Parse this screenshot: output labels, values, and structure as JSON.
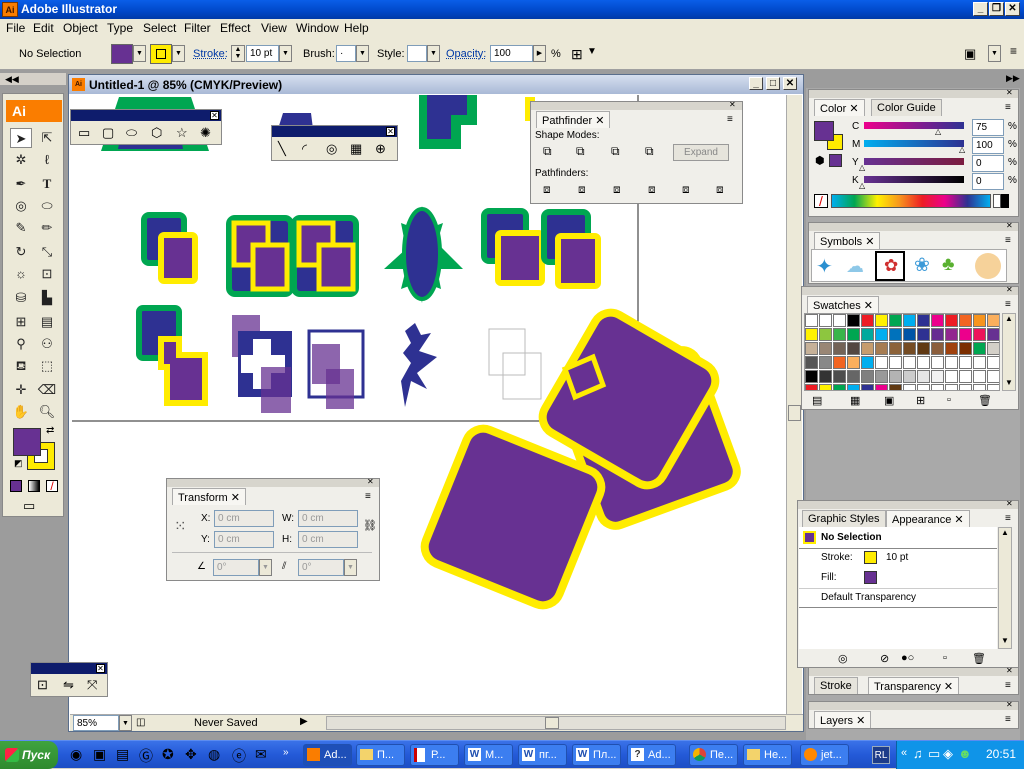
{
  "window": {
    "title": "Adobe Illustrator",
    "app_icon": "Ai"
  },
  "menu": [
    "File",
    "Edit",
    "Object",
    "Type",
    "Select",
    "Filter",
    "Effect",
    "View",
    "Window",
    "Help"
  ],
  "control": {
    "selection": "No Selection",
    "stroke_label": "Stroke:",
    "stroke_value": "10 pt",
    "brush_label": "Brush:",
    "style_label": "Style:",
    "opacity_label": "Opacity:",
    "opacity_value": "100",
    "opacity_unit": "%",
    "fill_color": "#673192",
    "stroke_color": "#ffec00"
  },
  "document": {
    "title": "Untitled-1 @ 85% (CMYK/Preview)",
    "zoom": "85%",
    "status": "Never Saved"
  },
  "toolbox": {
    "logo": "Ai"
  },
  "pathfinder": {
    "tab": "Pathfinder",
    "shape_modes": "Shape Modes:",
    "expand": "Expand",
    "pathfinders": "Pathfinders:"
  },
  "transform": {
    "tab": "Transform",
    "x_label": "X:",
    "x": "0 cm",
    "y_label": "Y:",
    "y": "0 cm",
    "w_label": "W:",
    "w": "0 cm",
    "h_label": "H:",
    "h": "0 cm",
    "angle": "0°",
    "shear": "0°"
  },
  "color_panel": {
    "tabs": [
      "Color",
      "Color Guide"
    ],
    "c_label": "C",
    "c": "75",
    "m_label": "M",
    "m": "100",
    "y_label": "Y",
    "y": "0",
    "k_label": "K",
    "k": "0",
    "unit": "%"
  },
  "symbols_panel": {
    "tab": "Symbols"
  },
  "swatches_panel": {
    "tab": "Swatches"
  },
  "appearance_panel": {
    "tabs": [
      "Graphic Styles",
      "Appearance"
    ],
    "selection": "No Selection",
    "stroke_label": "Stroke:",
    "stroke_value": "10 pt",
    "fill_label": "Fill:",
    "transparency": "Default Transparency"
  },
  "stroke_panel": {
    "tabs": [
      "Stroke",
      "Transparency"
    ]
  },
  "layers_panel": {
    "tab": "Layers"
  },
  "taskbar": {
    "start": "Пуск",
    "tasks": [
      "Ad...",
      "П...",
      "Р...",
      "М...",
      "пг...",
      "Пл...",
      "Ad...",
      "Пе...",
      "Не...",
      "jet..."
    ],
    "lang": "RL",
    "clock": "20:51"
  },
  "colors": {
    "purple": "#673192",
    "yellow": "#ffec00",
    "green": "#00a651",
    "navy": "#2e3192"
  }
}
